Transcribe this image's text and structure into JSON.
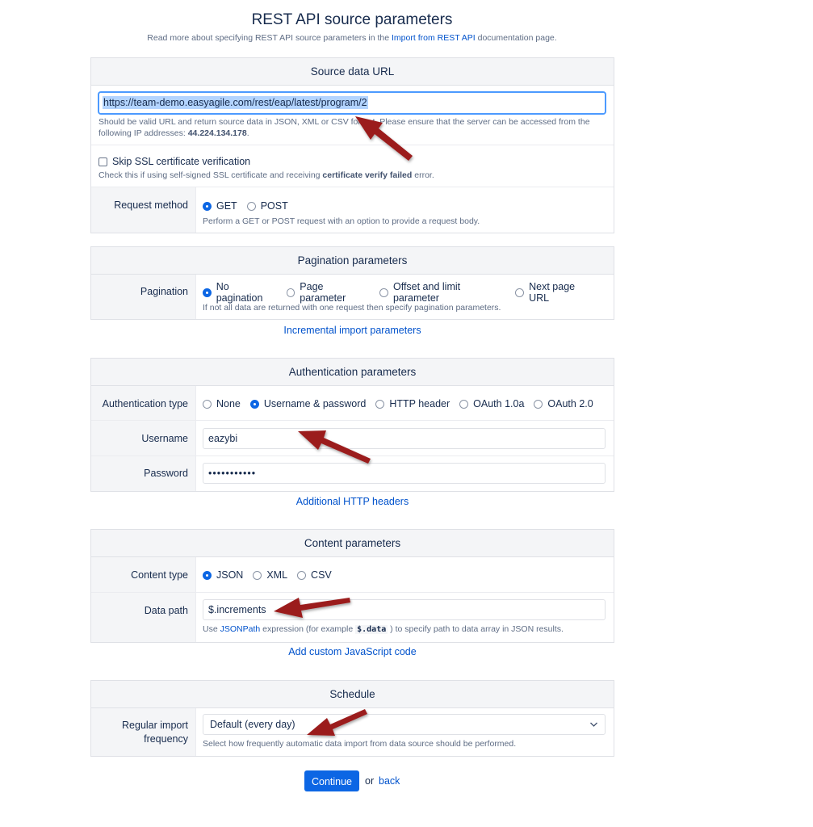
{
  "header": {
    "title": "REST API source parameters",
    "intro_prefix": "Read more about specifying REST API source parameters in the",
    "intro_link": "Import from REST API",
    "intro_suffix": "documentation page."
  },
  "source": {
    "heading": "Source data URL",
    "url_value": "https://team-demo.easyagile.com/rest/eap/latest/program/2",
    "url_help": "Should be valid URL and return source data in JSON, XML or CSV format. Please ensure that the server can be accessed from the following IP addresses:",
    "url_ip": "44.224.134.178",
    "url_help_end": ".",
    "ssl_label": "Skip SSL certificate verification",
    "ssl_checked": false,
    "ssl_help_prefix": "Check this if using self-signed SSL certificate and receiving",
    "ssl_help_bold": "certificate verify failed",
    "ssl_help_suffix": "error.",
    "method_label": "Request method",
    "method_options": [
      "GET",
      "POST"
    ],
    "method_selected": "GET",
    "method_help": "Perform a GET or POST request with an option to provide a request body."
  },
  "pagination": {
    "heading": "Pagination parameters",
    "label": "Pagination",
    "options": [
      "No pagination",
      "Page parameter",
      "Offset and limit parameter",
      "Next page URL"
    ],
    "selected": "No pagination",
    "help": "If not all data are returned with one request then specify pagination parameters.",
    "incremental_link": "Incremental import parameters"
  },
  "auth": {
    "heading": "Authentication parameters",
    "type_label": "Authentication type",
    "options": [
      "None",
      "Username & password",
      "HTTP header",
      "OAuth 1.0a",
      "OAuth 2.0"
    ],
    "selected": "Username & password",
    "username_label": "Username",
    "username_value": "eazybi",
    "password_label": "Password",
    "password_value": "•••••••••••",
    "headers_link": "Additional HTTP headers"
  },
  "content": {
    "heading": "Content parameters",
    "type_label": "Content type",
    "options": [
      "JSON",
      "XML",
      "CSV"
    ],
    "selected": "JSON",
    "path_label": "Data path",
    "path_value": "$.increments",
    "path_help_use": "Use",
    "path_help_link": "JSONPath",
    "path_help_mid": "expression (for example",
    "path_help_code": "$.data",
    "path_help_end": ") to specify path to data array in JSON results.",
    "js_link": "Add custom JavaScript code"
  },
  "schedule": {
    "heading": "Schedule",
    "freq_label_line1": "Regular import",
    "freq_label_line2": "frequency",
    "freq_value": "Default (every day)",
    "freq_help": "Select how frequently automatic data import from data source should be performed."
  },
  "actions": {
    "continue_label": "Continue",
    "or_text": "or",
    "back_label": "back"
  },
  "colors": {
    "link": "#0052cc",
    "primary_button": "#0c66e4",
    "arrow": "#9b1c1c"
  }
}
